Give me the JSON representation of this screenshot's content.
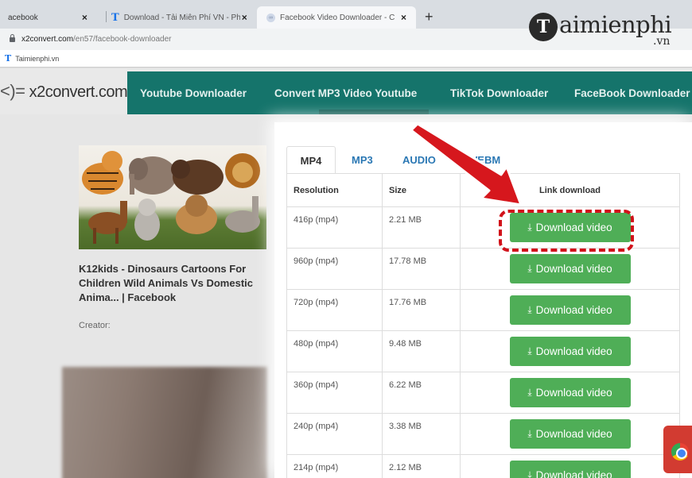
{
  "browser": {
    "tabs": [
      {
        "title": "acebook"
      },
      {
        "title": "Download - Tải Miễn Phí VN - Ph"
      },
      {
        "title": "Facebook Video Downloader - C"
      }
    ],
    "new_tab": "+",
    "address": {
      "host": "x2convert.com",
      "path": "/en57/facebook-downloader"
    },
    "bookmark": "Taimienphi.vn"
  },
  "watermark": {
    "letter": "T",
    "text": "aimienphi",
    "suffix": ".vn"
  },
  "site": {
    "logo": "x2convert.com",
    "nav": [
      "Youtube Downloader",
      "Convert MP3 Video Youtube",
      "TikTok Downloader",
      "FaceBook Downloader"
    ],
    "video": {
      "title": "K12kids - Dinosaurs Cartoons For Children Wild Animals Vs Domestic Anima... | Facebook",
      "creator": "Creator:"
    },
    "formats": [
      "MP4",
      "MP3",
      "AUDIO",
      "WEBM"
    ],
    "table": {
      "headers": [
        "Resolution",
        "Size",
        "Link download"
      ],
      "rows": [
        {
          "resolution": "416p (mp4)",
          "size": "2.21 MB",
          "button": "Download video"
        },
        {
          "resolution": "960p (mp4)",
          "size": "17.78 MB",
          "button": "Download video"
        },
        {
          "resolution": "720p (mp4)",
          "size": "17.76 MB",
          "button": "Download video"
        },
        {
          "resolution": "480p (mp4)",
          "size": "9.48 MB",
          "button": "Download video"
        },
        {
          "resolution": "360p (mp4)",
          "size": "6.22 MB",
          "button": "Download video"
        },
        {
          "resolution": "240p (mp4)",
          "size": "3.38 MB",
          "button": "Download video"
        },
        {
          "resolution": "214p (mp4)",
          "size": "2.12 MB",
          "button": "Download video"
        }
      ]
    }
  },
  "colors": {
    "nav": "#15746b",
    "button": "#4fae57",
    "highlight": "#d1121a"
  }
}
